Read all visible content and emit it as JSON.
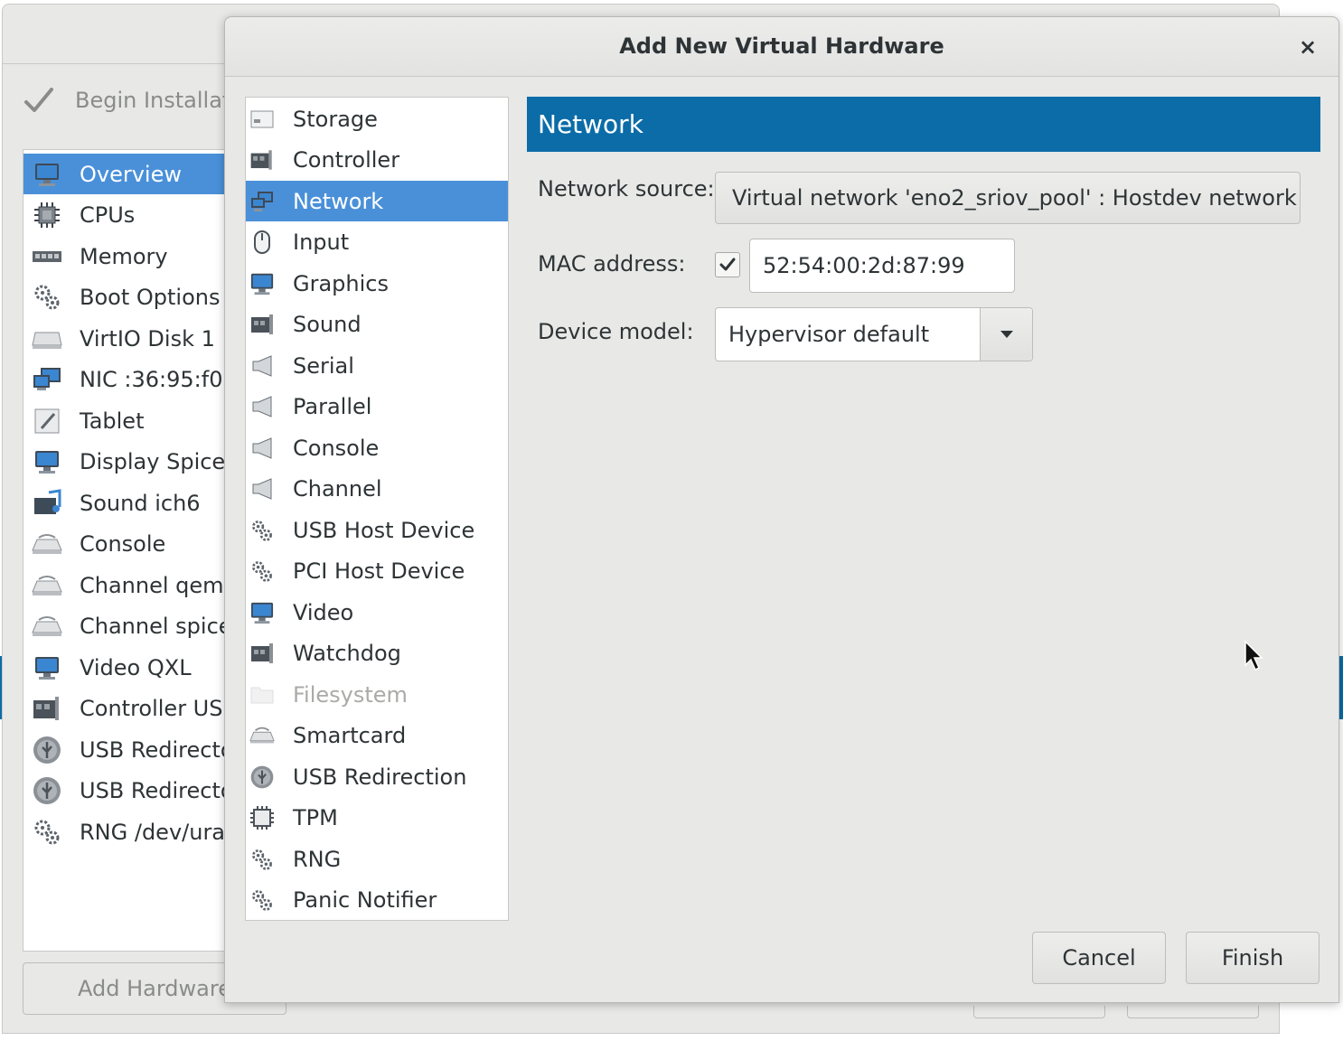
{
  "background_window": {
    "begin_installation": "Begin Installati",
    "items": [
      {
        "label": "Overview",
        "icon": "monitor-icon",
        "selected": true
      },
      {
        "label": "CPUs",
        "icon": "cpu-icon"
      },
      {
        "label": "Memory",
        "icon": "memory-icon"
      },
      {
        "label": "Boot Options",
        "icon": "gears-icon"
      },
      {
        "label": "VirtIO Disk 1",
        "icon": "disk-icon"
      },
      {
        "label": "NIC :36:95:f0",
        "icon": "nic-icon"
      },
      {
        "label": "Tablet",
        "icon": "tablet-icon"
      },
      {
        "label": "Display Spice",
        "icon": "monitor-icon"
      },
      {
        "label": "Sound ich6",
        "icon": "sound-icon"
      },
      {
        "label": "Console",
        "icon": "console-icon"
      },
      {
        "label": "Channel qemu-",
        "icon": "console-icon"
      },
      {
        "label": "Channel spice",
        "icon": "console-icon"
      },
      {
        "label": "Video QXL",
        "icon": "monitor-icon"
      },
      {
        "label": "Controller USB",
        "icon": "controller-icon"
      },
      {
        "label": "USB Redirecto",
        "icon": "usb-icon"
      },
      {
        "label": "USB Redirecto",
        "icon": "usb-icon"
      },
      {
        "label": "RNG /dev/uran",
        "icon": "gears-icon"
      }
    ],
    "add_hardware_label": "Add Hardware"
  },
  "dialog": {
    "title": "Add New Virtual Hardware",
    "close_glyph": "×",
    "hardware_list": [
      {
        "label": "Storage",
        "icon": "storage-icon"
      },
      {
        "label": "Controller",
        "icon": "controller-icon"
      },
      {
        "label": "Network",
        "icon": "network-icon",
        "selected": true
      },
      {
        "label": "Input",
        "icon": "mouse-icon"
      },
      {
        "label": "Graphics",
        "icon": "monitor-icon"
      },
      {
        "label": "Sound",
        "icon": "sound-card-icon"
      },
      {
        "label": "Serial",
        "icon": "serial-port-icon"
      },
      {
        "label": "Parallel",
        "icon": "parallel-port-icon"
      },
      {
        "label": "Console",
        "icon": "console-port-icon"
      },
      {
        "label": "Channel",
        "icon": "channel-port-icon"
      },
      {
        "label": "USB Host Device",
        "icon": "usb-device-icon"
      },
      {
        "label": "PCI Host Device",
        "icon": "pci-device-icon"
      },
      {
        "label": "Video",
        "icon": "video-icon"
      },
      {
        "label": "Watchdog",
        "icon": "watchdog-icon"
      },
      {
        "label": "Filesystem",
        "icon": "folder-icon",
        "disabled": true
      },
      {
        "label": "Smartcard",
        "icon": "smartcard-icon"
      },
      {
        "label": "USB Redirection",
        "icon": "usb-redirection-icon"
      },
      {
        "label": "TPM",
        "icon": "tpm-chip-icon"
      },
      {
        "label": "RNG",
        "icon": "rng-icon"
      },
      {
        "label": "Panic Notifier",
        "icon": "panic-notifier-icon"
      }
    ],
    "section_title": "Network",
    "network_source_label": "Network source:",
    "network_source_value": "Virtual network 'eno2_sriov_pool' : Hostdev network",
    "mac_label": "MAC address:",
    "mac_checked": true,
    "mac_value": "52:54:00:2d:87:99",
    "device_model_label": "Device model:",
    "device_model_value": "Hypervisor default",
    "cancel_label": "Cancel",
    "finish_label": "Finish"
  },
  "colors": {
    "selection": "#4a90d9",
    "banner": "#0b6ca8",
    "window_bg": "#e8e8e7"
  }
}
